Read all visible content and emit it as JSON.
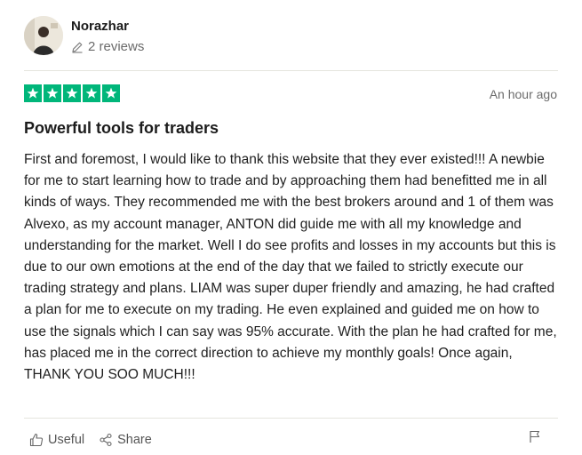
{
  "reviewer": {
    "name": "Norazhar",
    "reviews_count": "2 reviews",
    "avatar_icon": "user-photo-avatar"
  },
  "review": {
    "rating": 5,
    "rating_max": 5,
    "star_color": "#00b67a",
    "timestamp": "An hour ago",
    "title": "Powerful tools for traders",
    "body": "First and foremost, I would like to thank this website that they ever existed!!! A newbie for me to start learning how to trade and by approaching them had benefitted me in all kinds of ways. They recommended me with the best brokers around and 1 of them was Alvexo, as my account manager, ANTON did guide me with all my knowledge and understanding for the market. Well I do see profits and losses in my accounts but this is due to our own emotions at the end of the day that we failed to strictly execute our trading strategy and plans. LIAM was super duper friendly and amazing, he had crafted a plan for me to execute on my trading. He even explained and guided me on how to use the signals which I can say was 95% accurate. With the plan he had crafted for me, has placed me in the correct direction to achieve my monthly goals! Once again, THANK YOU SOO MUCH!!!"
  },
  "actions": {
    "useful_label": "Useful",
    "share_label": "Share",
    "useful_icon": "thumbs-up-icon",
    "share_icon": "share-icon",
    "report_icon": "flag-icon"
  }
}
